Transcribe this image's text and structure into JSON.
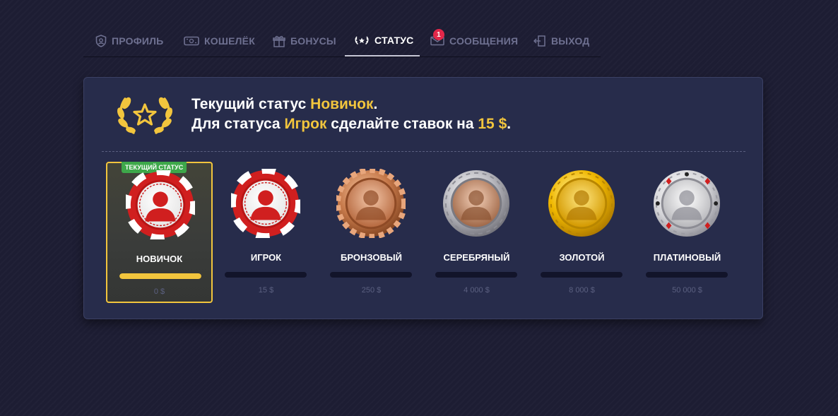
{
  "nav": {
    "tabs": [
      {
        "label": "ПРОФИЛЬ",
        "icon": "shield-user-icon"
      },
      {
        "label": "КОШЕЛЁК",
        "icon": "wallet-icon"
      },
      {
        "label": "БОНУСЫ",
        "icon": "gift-icon"
      },
      {
        "label": "СТАТУС",
        "icon": "laurel-star-icon",
        "active": true
      },
      {
        "label": "СООБЩЕНИЯ",
        "icon": "envelope-icon",
        "badge": "1"
      },
      {
        "label": "ВЫХОД",
        "icon": "logout-icon"
      }
    ]
  },
  "status": {
    "line1_prefix": "Текущий статус ",
    "current": "Новичок",
    "line1_suffix": ".",
    "line2_prefix": "Для статуса ",
    "next": "Игрок",
    "line2_middle": " сделайте ставок на ",
    "amount": "15 $",
    "line2_suffix": "."
  },
  "current_badge": "ТЕКУЩИЙ СТАТУС",
  "levels": [
    {
      "name": "НОВИЧОК",
      "amount": "0 $",
      "progress": 1.0,
      "current": true,
      "chip": "red-chip-icon"
    },
    {
      "name": "ИГРОК",
      "amount": "15 $",
      "progress": 0,
      "chip": "red-chip-icon"
    },
    {
      "name": "БРОНЗОВЫЙ",
      "amount": "250 $",
      "progress": 0,
      "chip": "bronze-chip-icon"
    },
    {
      "name": "СЕРЕБРЯНЫЙ",
      "amount": "4 000 $",
      "progress": 0,
      "chip": "silver-chip-icon"
    },
    {
      "name": "ЗОЛОТОЙ",
      "amount": "8 000 $",
      "progress": 0,
      "chip": "gold-chip-icon"
    },
    {
      "name": "ПЛАТИНОВЫЙ",
      "amount": "50 000 $",
      "progress": 0,
      "chip": "platinum-chip-icon"
    }
  ],
  "colors": {
    "accent": "#f2c53d",
    "badge_green": "#3ea84a",
    "message_badge": "#e3284a"
  }
}
